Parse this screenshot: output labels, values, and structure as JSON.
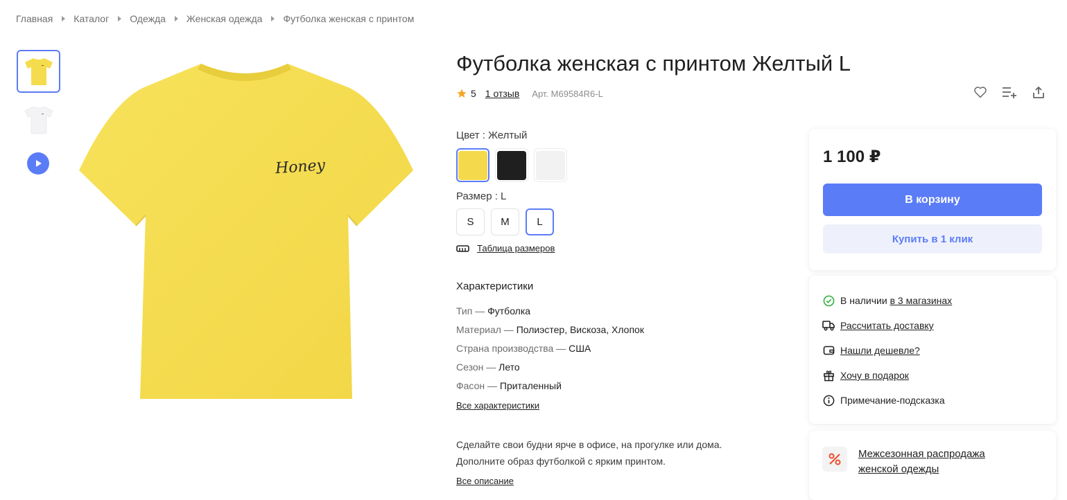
{
  "breadcrumb": [
    "Главная",
    "Каталог",
    "Одежда",
    "Женская одежда",
    "Футболка женская с принтом"
  ],
  "product": {
    "title": "Футболка женская с принтом Желтый L",
    "rating": "5",
    "reviews": "1 отзыв",
    "article": "Арт. M69584R6-L",
    "print_text": "Honey"
  },
  "gallery": {
    "active_index": 0,
    "thumbs": [
      "yellow-shirt",
      "white-shirt",
      "video"
    ]
  },
  "options": {
    "color_label": "Цвет : Желтый",
    "colors": [
      {
        "name": "Желтый",
        "hex": "#f4d94c",
        "selected": true
      },
      {
        "name": "Черный",
        "hex": "#1f1f1f",
        "selected": false
      },
      {
        "name": "Белый",
        "hex": "#f2f2f2",
        "selected": false
      }
    ],
    "size_label": "Размер : L",
    "sizes": [
      {
        "label": "S",
        "selected": false
      },
      {
        "label": "M",
        "selected": false
      },
      {
        "label": "L",
        "selected": true
      }
    ],
    "size_table": "Таблица размеров"
  },
  "characteristics": {
    "title": "Характеристики",
    "rows": [
      {
        "key": "Тип",
        "value": "Футболка"
      },
      {
        "key": "Материал",
        "value": "Полиэстер, Вискоза, Хлопок"
      },
      {
        "key": "Страна производства",
        "value": "США"
      },
      {
        "key": "Сезон",
        "value": "Лето"
      },
      {
        "key": "Фасон",
        "value": "Приталенный"
      }
    ],
    "separator": " — ",
    "all_link": "Все характеристики"
  },
  "description": {
    "line1": "Сделайте свои будни ярче в офисе, на прогулке или дома.",
    "line2": "Дополните образ футболкой с ярким принтом.",
    "all_link": "Все описание"
  },
  "purchase": {
    "price": "1 100 ₽",
    "cart_button": "В корзину",
    "one_click_button": "Купить в 1 клик"
  },
  "info": {
    "stock_prefix": "В наличии",
    "stock_link": "в 3 магазинах",
    "delivery": "Рассчитать доставку",
    "cheaper": "Нашли дешевле?",
    "gift": "Хочу в подарок",
    "note": "Примечание-подсказка"
  },
  "promo": {
    "text": "Межсезонная распродажа женской одежды"
  },
  "colors": {
    "accent": "#5b7cf7",
    "shirt": "#f4dc4e",
    "stock_ok": "#3bb54a",
    "promo": "#ef4d2e"
  }
}
